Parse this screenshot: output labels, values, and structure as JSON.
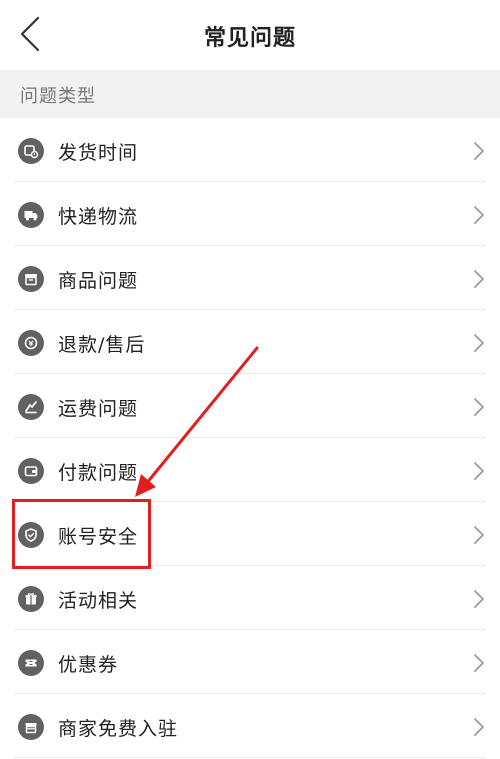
{
  "header": {
    "back_icon": "chevron-left-icon",
    "title": "常见问题"
  },
  "section": {
    "title": "问题类型"
  },
  "items": [
    {
      "label": "发货时间",
      "icon": "delivery-time-icon"
    },
    {
      "label": "快递物流",
      "icon": "truck-icon"
    },
    {
      "label": "商品问题",
      "icon": "box-icon"
    },
    {
      "label": "退款/售后",
      "icon": "refund-icon"
    },
    {
      "label": "运费问题",
      "icon": "shipping-fee-icon"
    },
    {
      "label": "付款问题",
      "icon": "wallet-icon"
    },
    {
      "label": "账号安全",
      "icon": "shield-icon"
    },
    {
      "label": "活动相关",
      "icon": "gift-icon"
    },
    {
      "label": "优惠券",
      "icon": "coupon-icon"
    },
    {
      "label": "商家免费入驻",
      "icon": "store-icon"
    }
  ],
  "annotation": {
    "highlighted_item": "账号安全",
    "color": "#e02020"
  },
  "colors": {
    "icon_bg": "#616161",
    "section_bg": "#f2f2f2",
    "chevron": "#9a9a9a"
  }
}
